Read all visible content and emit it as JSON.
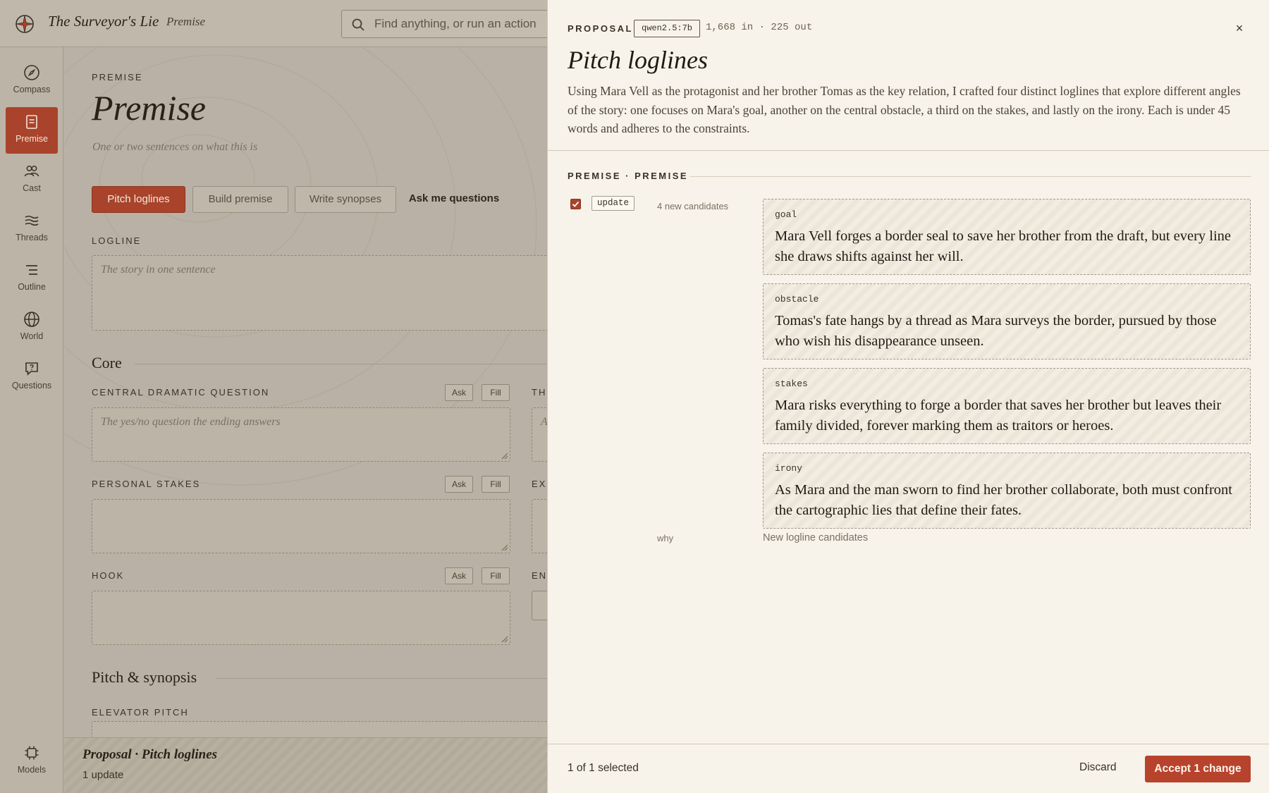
{
  "header": {
    "app_title": "The Surveyor's Lie",
    "crumb": "Premise",
    "search_placeholder": "Find anything, or run an action"
  },
  "rail": {
    "items": [
      {
        "label": "Compass",
        "icon": "compass-icon"
      },
      {
        "label": "Premise",
        "icon": "document-icon",
        "active": true
      },
      {
        "label": "Cast",
        "icon": "people-icon"
      },
      {
        "label": "Threads",
        "icon": "threads-icon"
      },
      {
        "label": "Outline",
        "icon": "outline-icon"
      },
      {
        "label": "World",
        "icon": "globe-icon"
      },
      {
        "label": "Questions",
        "icon": "question-icon"
      }
    ],
    "bottom": {
      "label": "Models",
      "icon": "chip-icon"
    }
  },
  "main": {
    "eyebrow": "PREMISE",
    "title": "Premise",
    "subtitle": "One or two sentences on what this is",
    "actions": {
      "pitch": "Pitch loglines",
      "build": "Build premise",
      "write": "Write synopses",
      "ask": "Ask me questions"
    },
    "logline": {
      "label": "LOGLINE",
      "placeholder": "The story in one sentence"
    },
    "core": {
      "title": "Core",
      "fields": [
        {
          "label": "CENTRAL DRAMATIC QUESTION",
          "placeholder": "The yes/no question the ending answers"
        },
        {
          "label": "PERSONAL STAKES",
          "placeholder": ""
        },
        {
          "label": "HOOK",
          "placeholder": ""
        }
      ],
      "ask_label": "Ask",
      "fill_label": "Fill",
      "right_col_labels": [
        "TH",
        "EX",
        "EN"
      ],
      "right_col_placeholder": "A"
    },
    "pitch_section": {
      "title": "Pitch & synopsis",
      "elevator_label": "ELEVATOR PITCH"
    }
  },
  "statusbar": {
    "title": "Proposal · Pitch loglines",
    "sub": "1 update"
  },
  "proposal": {
    "kicker": "PROPOSAL",
    "model": "qwen2.5:7b",
    "tokens": "1,668 in · 225 out",
    "close": "×",
    "title": "Pitch loglines",
    "summary": "Using Mara Vell as the protagonist and her brother Tomas as the key relation, I crafted four distinct loglines that explore different angles of the story: one focuses on Mara's goal, another on the central obstacle, a third on the stakes, and lastly on the irony. Each is under 45 words and adheres to the constraints.",
    "section": "PREMISE · PREMISE",
    "change": {
      "checked": true,
      "tag": "update",
      "count": "4 new candidates",
      "candidates": [
        {
          "key": "goal",
          "text": "Mara Vell forges a border seal to save her brother from the draft, but every line she draws shifts against her will."
        },
        {
          "key": "obstacle",
          "text": "Tomas's fate hangs by a thread as Mara surveys the border, pursued by those who wish his disappearance unseen."
        },
        {
          "key": "stakes",
          "text": "Mara risks everything to forge a border that saves her brother but leaves their family divided, forever marking them as traitors or heroes."
        },
        {
          "key": "irony",
          "text": "As Mara and the man sworn to find her brother collaborate, both must confront the cartographic lies that define their fates."
        }
      ],
      "why_label": "why",
      "why_text": "New logline candidates"
    },
    "footer": {
      "selected": "1 of 1 selected",
      "discard": "Discard",
      "accept": "Accept 1 change"
    }
  },
  "colors": {
    "accent": "#a9432b",
    "panel_bg": "#f7f3ea",
    "dim_bg": "#b9b1a5"
  }
}
